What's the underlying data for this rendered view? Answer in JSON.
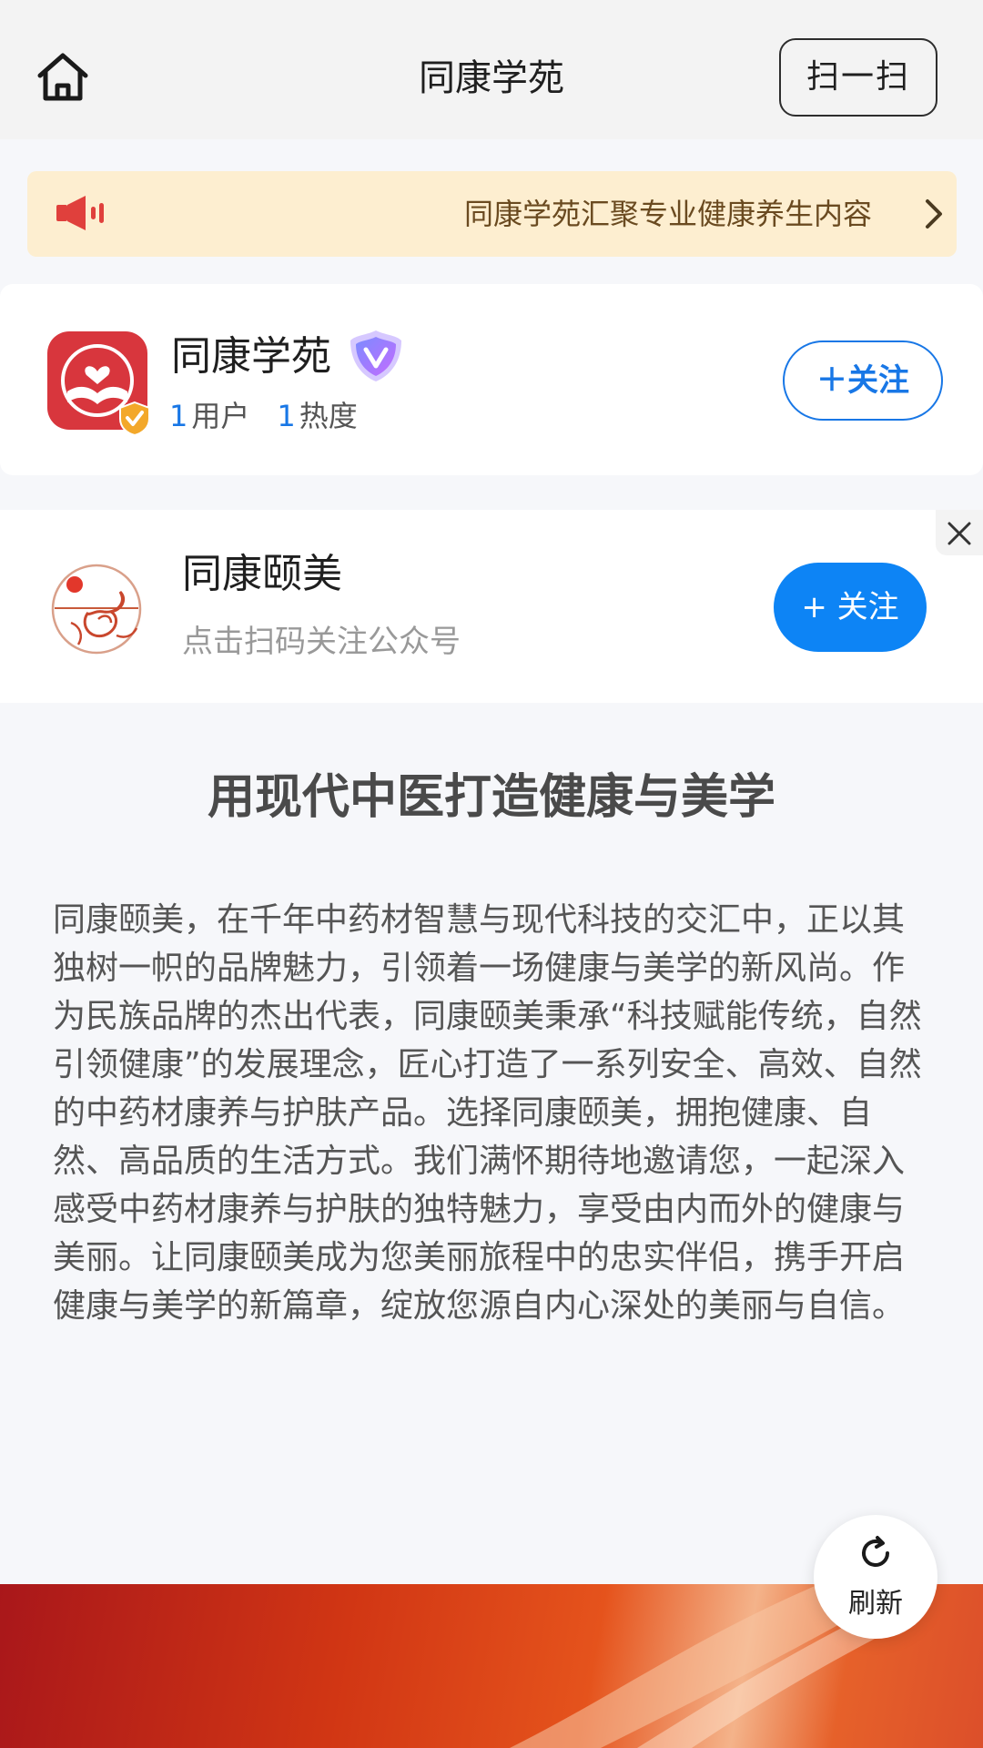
{
  "header": {
    "title": "同康学苑",
    "scan_label": "扫一扫"
  },
  "notice": {
    "text": "同康学苑汇聚专业健康养生内容"
  },
  "account_card": {
    "name": "同康学苑",
    "users_count": "1",
    "users_label": "用户",
    "heat_count": "1",
    "heat_label": "热度",
    "follow_label": "＋关注"
  },
  "official_card": {
    "name": "同康颐美",
    "subtitle": "点击扫码关注公众号",
    "follow_label": "+ 关注"
  },
  "article": {
    "title": "用现代中医打造健康与美学",
    "body": "同康颐美，在千年中药材智慧与现代科技的交汇中，正以其独树一帜的品牌魅力，引领着一场健康与美学的新风尚。作为民族品牌的杰出代表，同康颐美秉承“科技赋能传统，自然引领健康”的发展理念，匠心打造了一系列安全、高效、自然的中药材康养与护肤产品。选择同康颐美，拥抱健康、自然、高品质的生活方式。我们满怀期待地邀请您，一起深入感受中药材康养与护肤的独特魅力，享受由内而外的健康与美丽。让同康颐美成为您美丽旅程中的忠实伴侣，携手开启健康与美学的新篇章，绽放您源自内心深处的美丽与自信。"
  },
  "refresh": {
    "label": "刷新"
  },
  "colors": {
    "accent_blue": "#1877e6",
    "follow_solid": "#0d84f5",
    "notice_bg": "#fdeed0",
    "logo_red": "#d8363d"
  },
  "icons": {
    "home": "home-icon",
    "speaker": "speaker-icon",
    "arrow": "chevron-right-icon",
    "verified": "verified-badge-icon",
    "vip": "vip-shield-icon",
    "close": "close-icon",
    "refresh": "refresh-icon"
  }
}
